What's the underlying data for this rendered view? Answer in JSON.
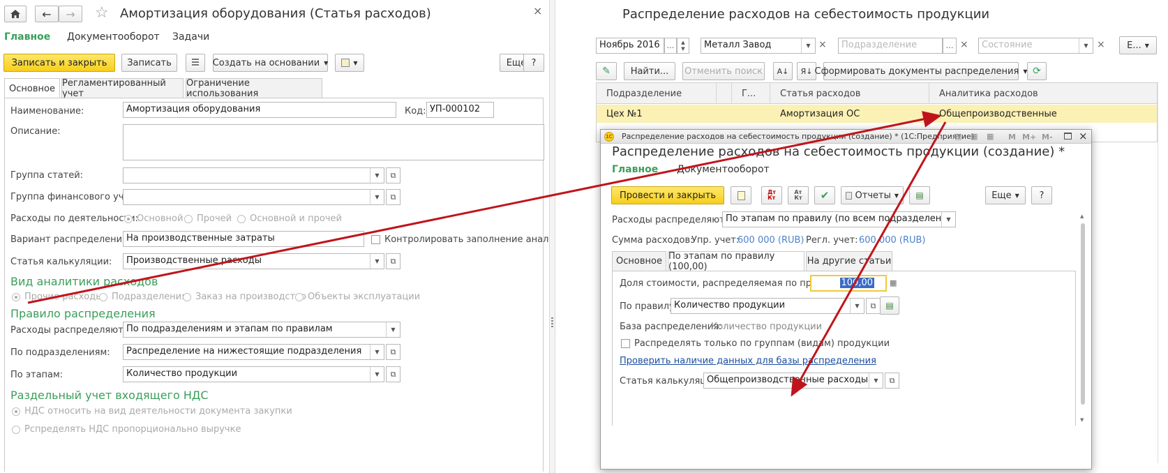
{
  "left": {
    "title": "Амортизация оборудования (Статья расходов)",
    "nav": [
      "Главное",
      "Документооборот",
      "Задачи"
    ],
    "toolbar": {
      "save_close": "Записать и закрыть",
      "save": "Записать",
      "create_based": "Создать на основании",
      "more": "Еще",
      "help": "?"
    },
    "tabs": [
      "Основное",
      "Регламентированный учет",
      "Ограничение использования"
    ],
    "fields": {
      "name_label": "Наименование:",
      "name_value": "Амортизация оборудования",
      "code_label": "Код:",
      "code_value": "УП-000102",
      "desc_label": "Описание:",
      "group_label": "Группа статей:",
      "fin_group_label": "Группа финансового учета:",
      "activity_label": "Расходы по деятельности:",
      "activity_options": [
        "Основной",
        "Прочей",
        "Основной и прочей"
      ],
      "variant_label": "Вариант распределения:",
      "variant_value": "На производственные затраты",
      "control_check": "Контролировать заполнение аналитики",
      "calc_label": "Статья калькуляции:",
      "calc_value": "Производственные расходы"
    },
    "analytics": {
      "header": "Вид аналитики расходов",
      "options": [
        "Прочие расходы",
        "Подразделения",
        "Заказ на производство",
        "Объекты эксплуатации"
      ]
    },
    "distribution": {
      "header": "Правило распределения",
      "spread_label": "Расходы распределяются:",
      "spread_value": "По подразделениям и этапам по правилам",
      "by_dept_label": "По подразделениям:",
      "by_dept_value": "Распределение на нижестоящие подразделения",
      "by_stage_label": "По этапам:",
      "by_stage_value": "Количество продукции"
    },
    "vat": {
      "header": "Раздельный учет входящего НДС",
      "options": [
        "НДС относить на вид деятельности документа закупки",
        "Рспределять НДС пропорционально выручке"
      ]
    }
  },
  "right": {
    "title": "Распределение расходов на себестоимость продукции",
    "filters": {
      "period": "Ноябрь 2016",
      "org": "Металл Завод",
      "dept_placeholder": "Подразделение",
      "state_placeholder": "Состояние",
      "extra": "Е..."
    },
    "toolbar": {
      "find": "Найти...",
      "cancel_search": "Отменить поиск",
      "form_docs": "Сформировать документы распределения"
    },
    "table": {
      "columns": [
        "Подразделение",
        "",
        "Г...",
        "Статья расходов",
        "Аналитика расходов"
      ],
      "rows": [
        {
          "dept": "Цех №1",
          "item": "Амортизация ОС",
          "analytics": "Общепроизводственные"
        }
      ]
    }
  },
  "dialog": {
    "window_title": "Распределение расходов на себестоимость продукции (создание) * (1С:Предприятие)",
    "heading": "Распределение расходов на себестоимость продукции (создание) *",
    "nav": [
      "Главное",
      "Документооборот"
    ],
    "toolbar": {
      "post_close": "Провести и закрыть",
      "reports": "Отчеты",
      "more": "Еще",
      "help": "?"
    },
    "titlebar_buttons": [
      "M",
      "M+",
      "M-"
    ],
    "spread_label": "Расходы распределяются:",
    "spread_value": "По этапам по правилу (по всем подразделениям)",
    "sum_label": "Сумма расходов:",
    "upr_label": "Упр. учет:",
    "upr_value": "600 000 (RUB)",
    "regl_label": "Регл. учет:",
    "regl_value": "600 000 (RUB)",
    "tabs": [
      "Основное",
      "По этапам по правилу (100,00)",
      "На другие статьи"
    ],
    "share_label": "Доля стоимости, распределяемая по правилам:",
    "share_value": "100,00",
    "rule_label": "По правилу:",
    "rule_value": "Количество продукции",
    "base_label": "База распределения:",
    "base_value": "Количество продукции",
    "group_check": "Распределять только по группам (видам) продукции",
    "check_link": "Проверить наличие данных для базы распределения",
    "calc_label": "Статья калькуляции:",
    "calc_value": "Общепроизводственные расходы"
  },
  "colors": {
    "accent_green": "#3a9e5a",
    "yellow_button": "#f6ce1c",
    "highlight_row": "#fbf1b4",
    "arrow": "#c0141c"
  }
}
